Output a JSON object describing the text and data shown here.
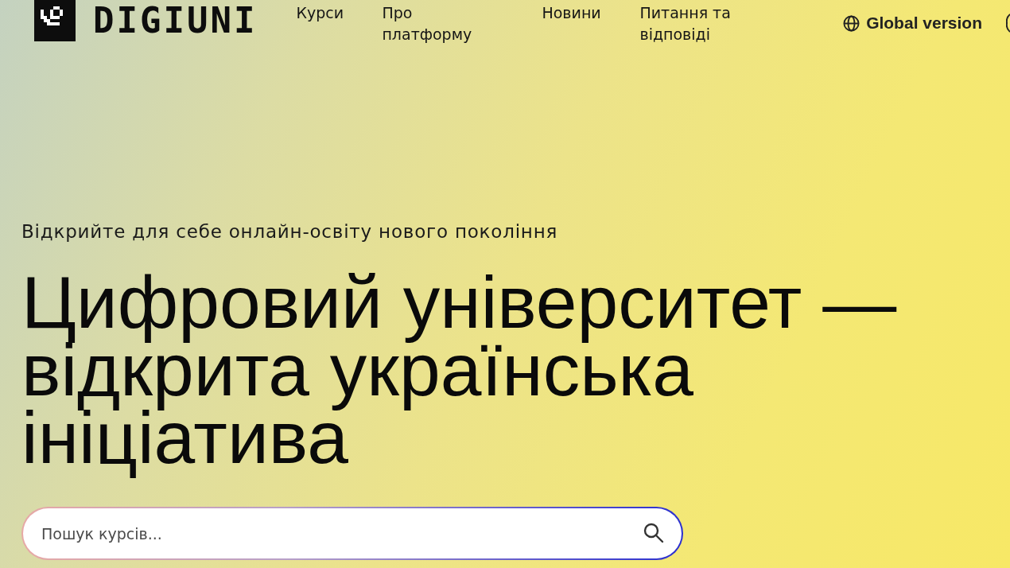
{
  "header": {
    "logo": {
      "text": "DIGIUNI"
    },
    "nav": [
      {
        "label": "Курси"
      },
      {
        "label": "Про платформу"
      },
      {
        "label": "Новини"
      },
      {
        "label": "Питання та відповіді"
      }
    ],
    "language_link": {
      "label": "Global version"
    }
  },
  "hero": {
    "tagline": "Відкрийте для себе онлайн-освіту нового покоління",
    "title": "Цифровий університет — відкрита українська ініціатива",
    "search": {
      "placeholder": "Пошук курсів..."
    }
  }
}
